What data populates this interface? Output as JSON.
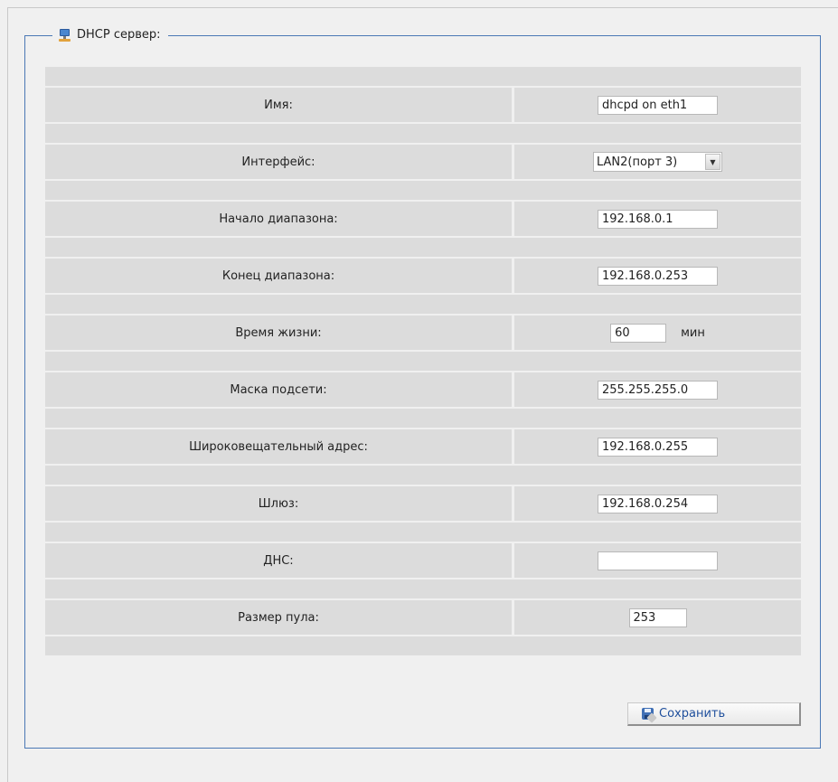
{
  "panel": {
    "title": "DHCP сервер:",
    "icon": "network-computer-icon",
    "border_color": "#4b78b5"
  },
  "form": {
    "name": {
      "label": "Имя:",
      "value": "dhcpd on eth1"
    },
    "interface": {
      "label": "Интерфейс:",
      "value": "LAN2(порт 3)"
    },
    "range_start": {
      "label": "Начало диапазона:",
      "value": "192.168.0.1"
    },
    "range_end": {
      "label": "Конец диапазона:",
      "value": "192.168.0.253"
    },
    "lease_time": {
      "label": "Время жизни:",
      "value": "60",
      "unit": "мин"
    },
    "netmask": {
      "label": "Маска подсети:",
      "value": "255.255.255.0"
    },
    "broadcast": {
      "label": "Широковещательный адрес:",
      "value": "192.168.0.255"
    },
    "gateway": {
      "label": "Шлюз:",
      "value": "192.168.0.254"
    },
    "dns": {
      "label": "ДНС:",
      "value": ""
    },
    "pool_size": {
      "label": "Размер пула:",
      "value": "253"
    }
  },
  "actions": {
    "save_label": "Сохранить",
    "save_icon": "floppy-disk-icon"
  }
}
